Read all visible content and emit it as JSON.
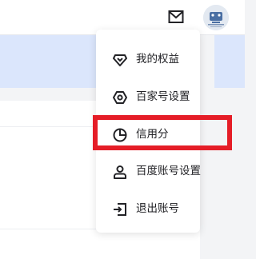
{
  "header": {
    "mail_icon": "envelope-icon",
    "avatar_icon": "avatar-icon"
  },
  "account_menu": {
    "items": [
      {
        "label": "我的权益",
        "icon": "diamond-shield-icon"
      },
      {
        "label": "百家号设置",
        "icon": "hexagon-settings-icon"
      },
      {
        "label": "信用分",
        "icon": "pie-chart-icon",
        "highlighted": true
      },
      {
        "label": "百度账号设置",
        "icon": "user-icon"
      },
      {
        "label": "退出账号",
        "icon": "logout-icon"
      }
    ]
  },
  "colors": {
    "highlight": "#e51d27",
    "banner": "#dbe6fc",
    "icon": "#222226"
  }
}
